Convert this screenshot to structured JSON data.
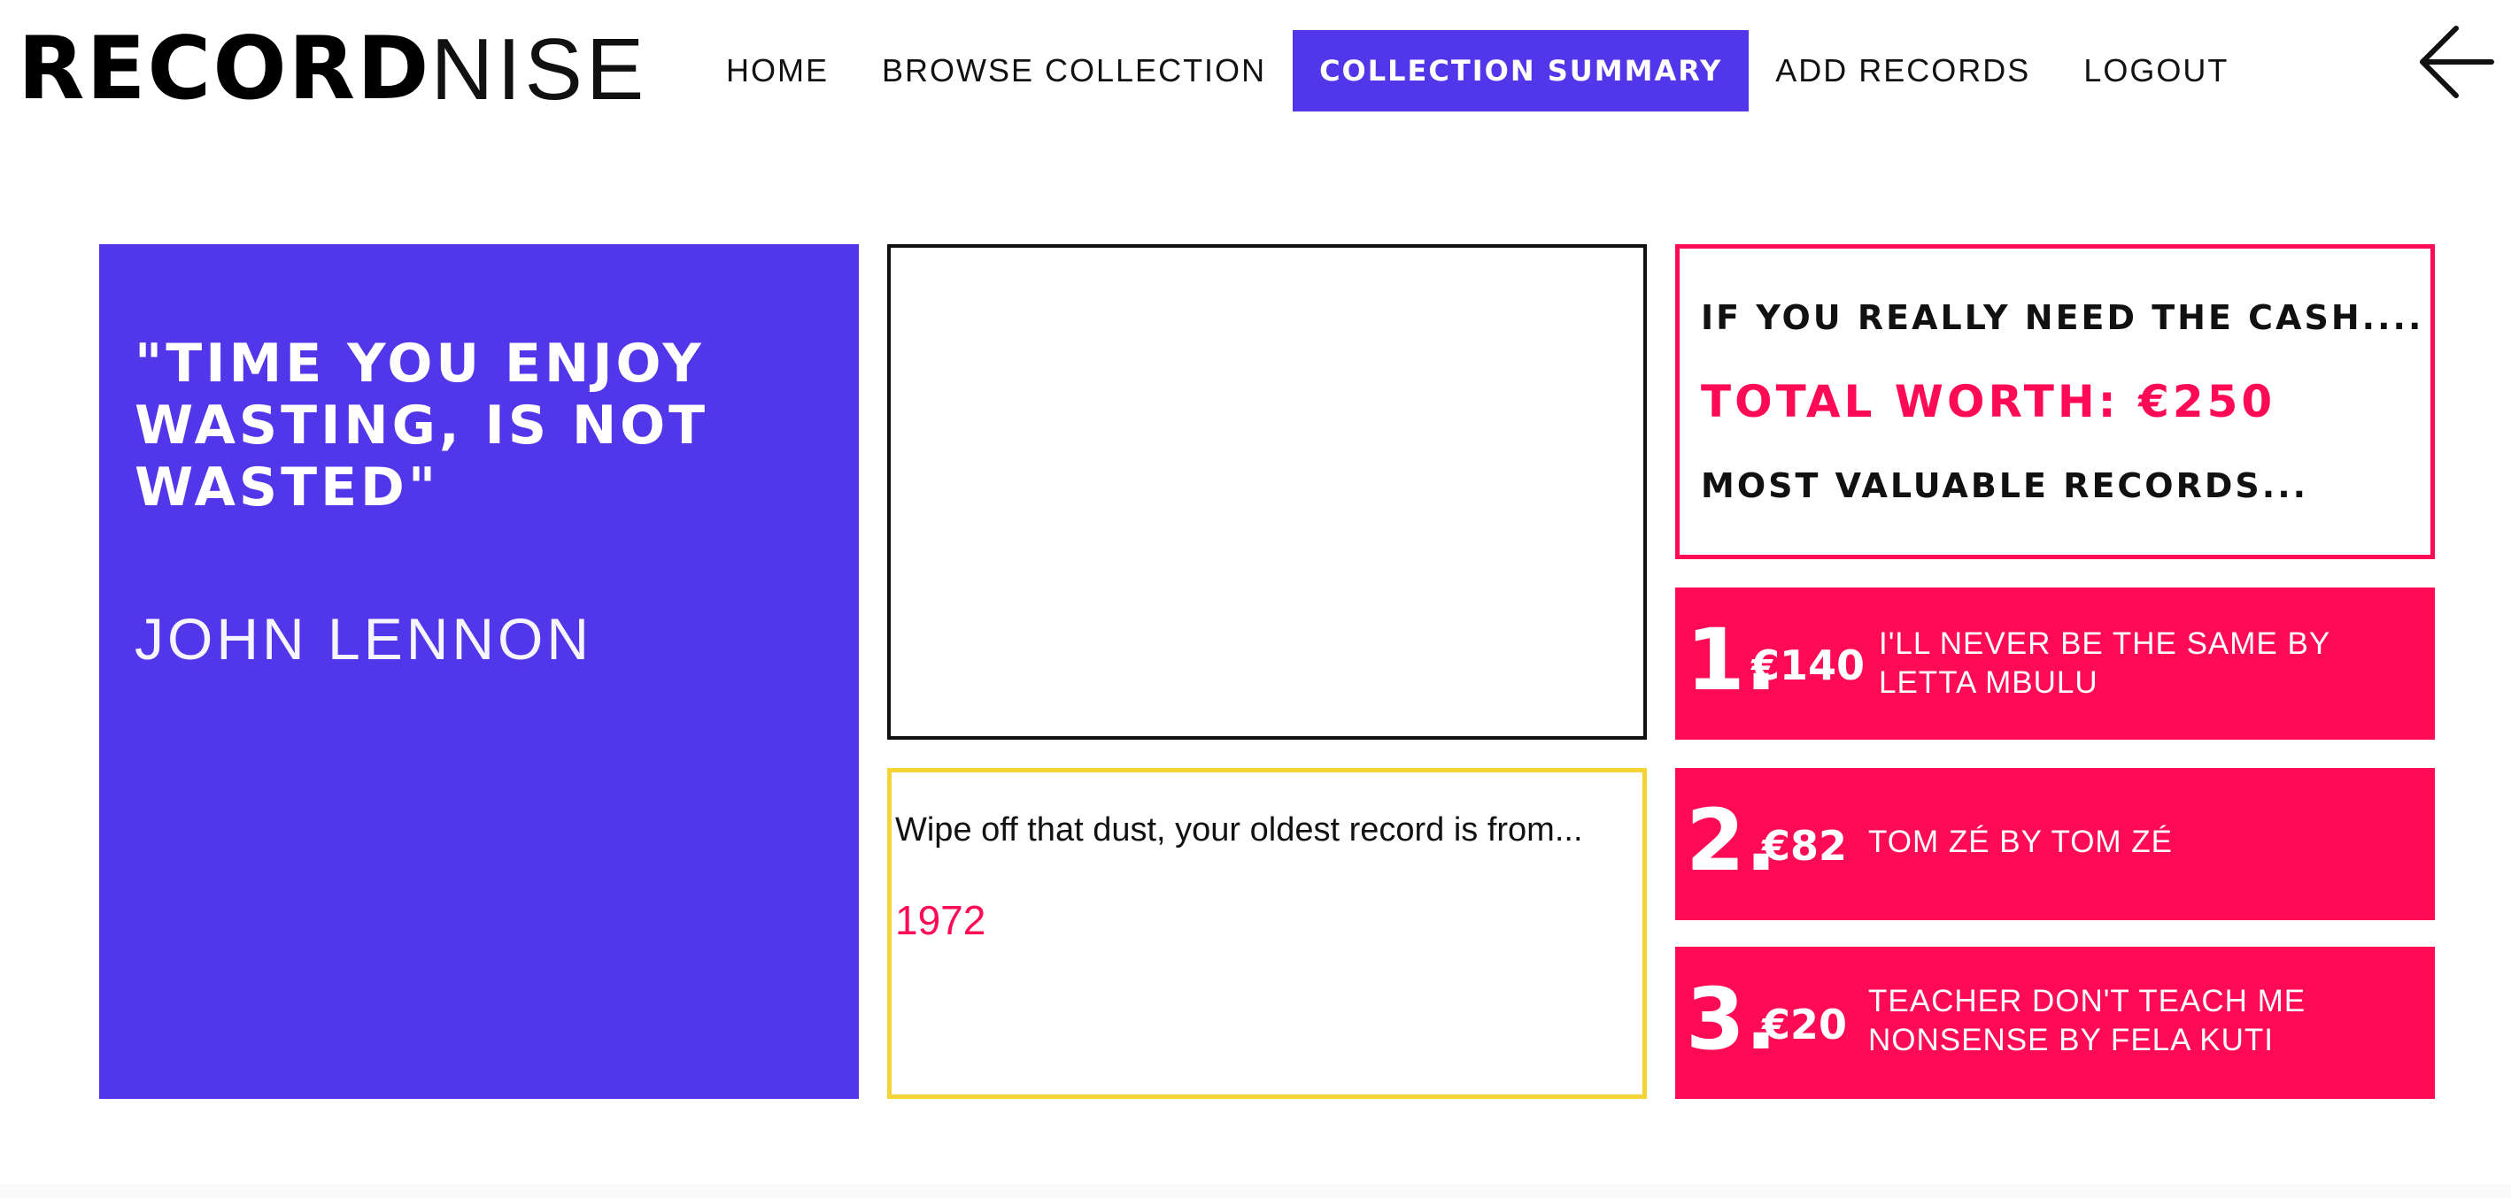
{
  "logo": {
    "bold": "RECORD",
    "thin": "NISE"
  },
  "nav": {
    "items": [
      {
        "label": "HOME",
        "active": false
      },
      {
        "label": "BROWSE COLLECTION",
        "active": false
      },
      {
        "label": "COLLECTION SUMMARY",
        "active": true
      },
      {
        "label": "ADD RECORDS",
        "active": false
      },
      {
        "label": "LOGOUT",
        "active": false
      }
    ],
    "back_icon": "arrow-left-icon"
  },
  "quote": {
    "text": "\"TIME YOU ENJOY WASTING, IS NOT WASTED\"",
    "author": "JOHN LENNON"
  },
  "oldest": {
    "text": "Wipe off that dust, your oldest record is from...",
    "year": "1972"
  },
  "worth": {
    "heading": "IF YOU REALLY NEED THE CASH....",
    "total": "TOTAL WORTH: €250",
    "subheading": "MOST VALUABLE RECORDS..."
  },
  "top_records": [
    {
      "rank": "1.",
      "price": "€140",
      "title": "I'LL NEVER BE THE SAME BY LETTA MBULU"
    },
    {
      "rank": "2.",
      "price": "€82",
      "title": "TOM ZÉ BY TOM ZÉ"
    },
    {
      "rank": "3.",
      "price": "€20",
      "title": "TEACHER DON'T TEACH ME NONSENSE BY FELA KUTI"
    }
  ],
  "colors": {
    "purple": "#5236e9",
    "pink": "#ff0a54",
    "yellow": "#f5d437"
  }
}
